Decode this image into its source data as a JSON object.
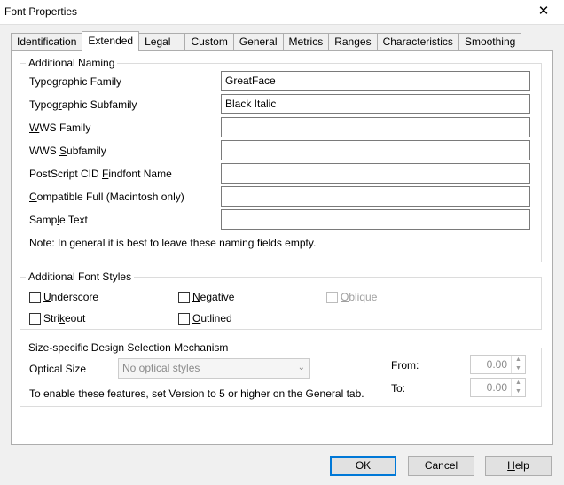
{
  "window": {
    "title": "Font Properties"
  },
  "tabs": [
    {
      "label": "Identification"
    },
    {
      "label": "Extended"
    },
    {
      "label": "Legal"
    },
    {
      "label": "Custom"
    },
    {
      "label": "General"
    },
    {
      "label": "Metrics"
    },
    {
      "label": "Ranges"
    },
    {
      "label": "Characteristics"
    },
    {
      "label": "Smoothing"
    }
  ],
  "active_tab": "Extended",
  "naming": {
    "legend": "Additional Naming",
    "fields": [
      {
        "label_pre": "Typo",
        "mnemonic": "g",
        "label_post": "raphic Family",
        "value": "GreatFace"
      },
      {
        "label_pre": "Typog",
        "mnemonic": "r",
        "label_post": "aphic Subfamily",
        "value": "Black Italic"
      },
      {
        "label_pre": "",
        "mnemonic": "W",
        "label_post": "WS Family",
        "value": ""
      },
      {
        "label_pre": "WWS ",
        "mnemonic": "S",
        "label_post": "ubfamily",
        "value": ""
      },
      {
        "label_pre": "PostScript CID ",
        "mnemonic": "F",
        "label_post": "indfont Name",
        "value": ""
      },
      {
        "label_pre": "",
        "mnemonic": "C",
        "label_post": "ompatible Full (Macintosh only)",
        "value": ""
      },
      {
        "label_pre": "Samp",
        "mnemonic": "l",
        "label_post": "e Text",
        "value": ""
      }
    ],
    "note": "Note: In general it is best to leave these naming fields empty."
  },
  "styles": {
    "legend": "Additional Font Styles",
    "underscore": {
      "pre": "",
      "mn": "U",
      "post": "nderscore"
    },
    "negative": {
      "pre": "",
      "mn": "N",
      "post": "egative"
    },
    "oblique": {
      "pre": "",
      "mn": "O",
      "post": "blique"
    },
    "strikeout": {
      "pre": "Stri",
      "mn": "k",
      "post": "eout"
    },
    "outlined": {
      "pre": "",
      "mn": "O",
      "post": "utlined"
    }
  },
  "size": {
    "legend": "Size-specific Design Selection Mechanism",
    "optical_label": "Optical Size",
    "optical_value": "No optical styles",
    "from_label": "From:",
    "from_value": "0.00",
    "to_label": "To:",
    "to_value": "0.00",
    "hint": "To enable these features, set Version to 5 or higher on the General tab."
  },
  "buttons": {
    "ok": "OK",
    "cancel": "Cancel",
    "help": {
      "pre": "",
      "mn": "H",
      "post": "elp"
    }
  }
}
